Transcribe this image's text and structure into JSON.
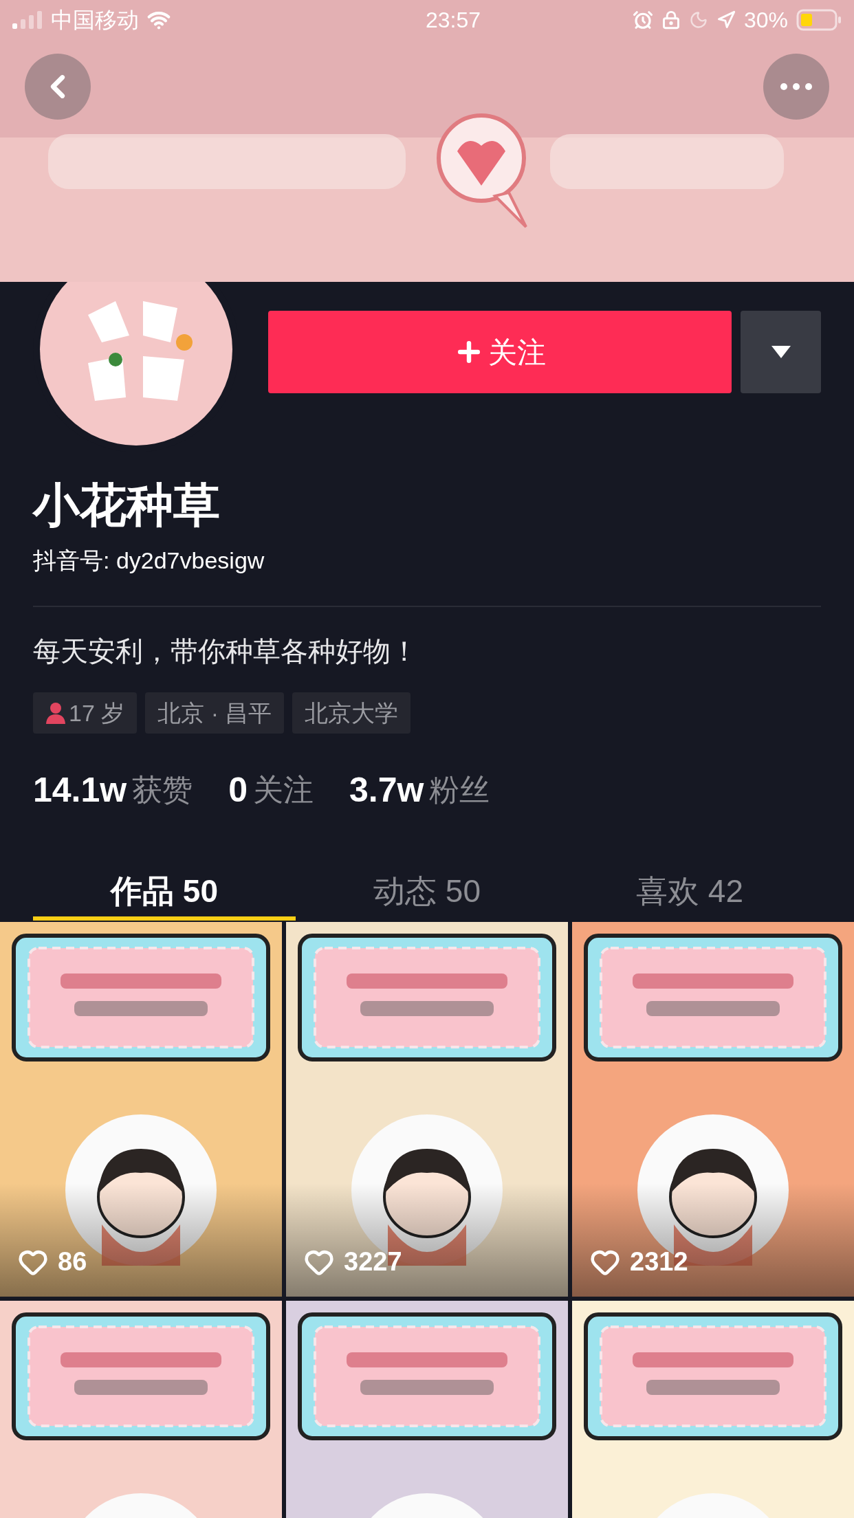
{
  "status_bar": {
    "carrier": "中国移动",
    "time": "23:57",
    "battery": "30%"
  },
  "profile": {
    "name": "小花种草",
    "douyin_id": "抖音号: dy2d7vbesigw",
    "bio": "每天安利，带你种草各种好物！"
  },
  "follow_button": {
    "label": "关注"
  },
  "tags": [
    {
      "kind": "gender",
      "label": "17 岁",
      "color": "#e2455f"
    },
    {
      "kind": "text",
      "label": "北京 · 昌平"
    },
    {
      "kind": "text",
      "label": "北京大学"
    }
  ],
  "stats": [
    {
      "count": "14.1w",
      "caption": "获赞"
    },
    {
      "count": "0",
      "caption": "关注"
    },
    {
      "count": "3.7w",
      "caption": "粉丝"
    }
  ],
  "tabs": [
    {
      "label": "作品 50",
      "selected": true
    },
    {
      "label": "动态 50",
      "selected": false
    },
    {
      "label": "喜欢 42",
      "selected": false
    }
  ],
  "videos": [
    {
      "kind": "picture",
      "likes": "86"
    },
    {
      "kind": "picture",
      "likes": "3227"
    },
    {
      "kind": "picture",
      "likes": "2312"
    },
    {
      "kind": "picture"
    },
    {
      "kind": "picture"
    },
    {
      "kind": "picture"
    }
  ]
}
